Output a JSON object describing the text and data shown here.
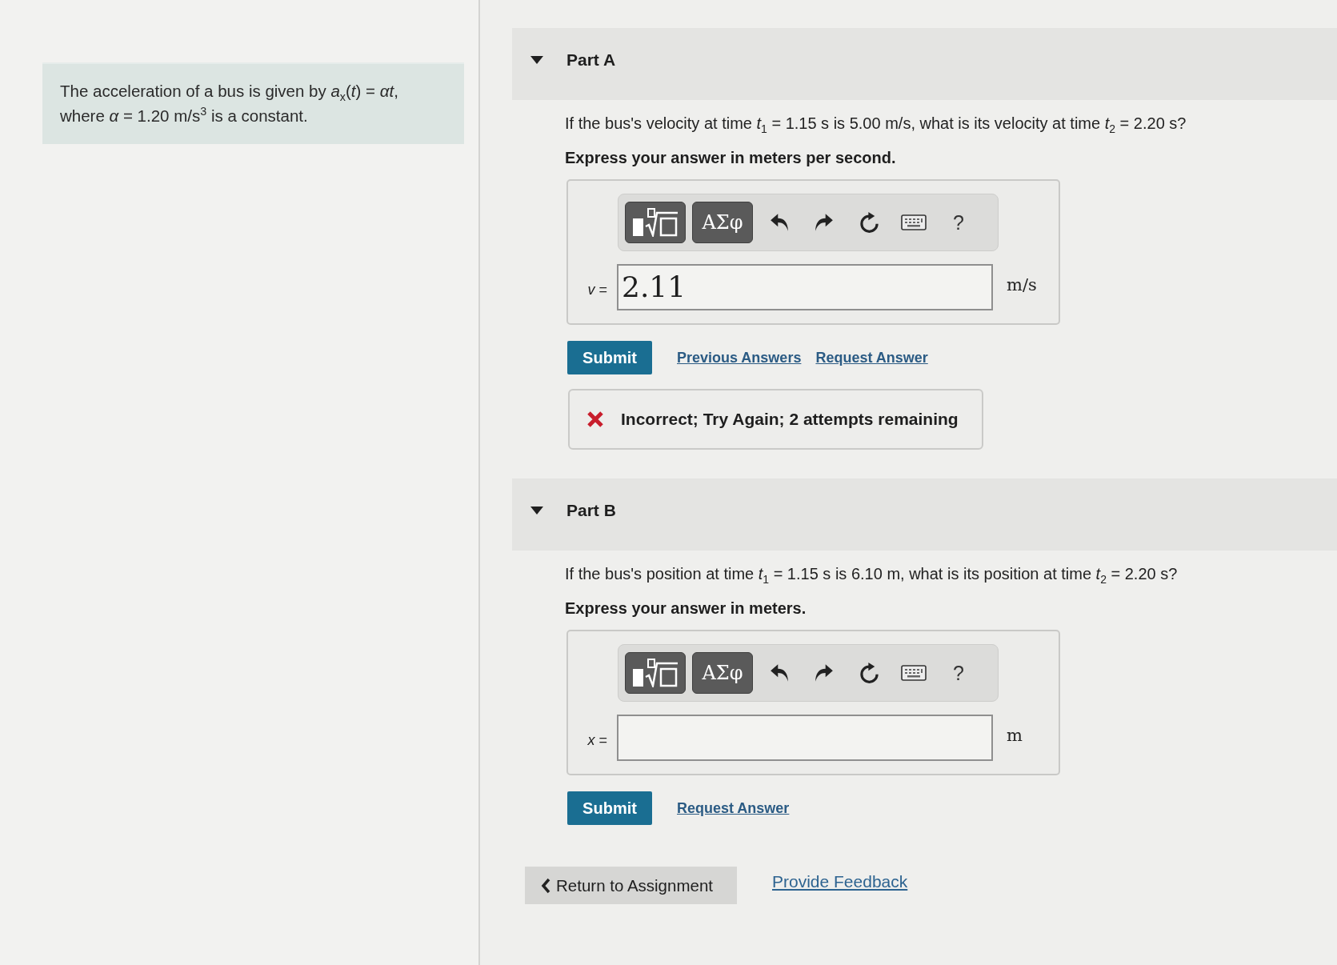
{
  "problem": {
    "text": "The acceleration of a bus is given by *a*$_{x}$(*t*) = *αt*, where *α* = 1.20 m/s$^{3}$ is a constant."
  },
  "parts": [
    {
      "title": "Part A",
      "expanded": true,
      "question": "If the bus's velocity at time *t*$_{1}$ = 1.15 s is 5.00 m/s, what is its velocity at time *t*$_{2}$ = 2.20 s?",
      "instruction": "Express your answer in meters per second.",
      "toolbar": [
        {
          "kind": "templates"
        },
        {
          "kind": "symbols",
          "label": "ΑΣφ"
        },
        {
          "kind": "undo"
        },
        {
          "kind": "redo"
        },
        {
          "kind": "reset"
        },
        {
          "kind": "keyboard"
        },
        {
          "kind": "help",
          "label": "?"
        }
      ],
      "variable": "*v* =",
      "value": "2.11",
      "unit": "m/s",
      "actions": [
        {
          "kind": "submit",
          "label": "Submit"
        },
        {
          "kind": "link",
          "label": "Previous Answers"
        },
        {
          "kind": "link",
          "label": "Request Answer"
        }
      ],
      "feedback": {
        "correct": false,
        "text": "Incorrect; Try Again; 2 attempts remaining"
      }
    },
    {
      "title": "Part B",
      "expanded": true,
      "question": "If the bus's position at time *t*$_{1}$ = 1.15 s is 6.10 m, what is its position at time *t*$_{2}$ = 2.20 s?",
      "instruction": "Express your answer in meters.",
      "toolbar": [
        {
          "kind": "templates"
        },
        {
          "kind": "symbols",
          "label": "ΑΣφ"
        },
        {
          "kind": "undo"
        },
        {
          "kind": "redo"
        },
        {
          "kind": "reset"
        },
        {
          "kind": "keyboard"
        },
        {
          "kind": "help",
          "label": "?"
        }
      ],
      "variable": "*x* =",
      "unit": "m",
      "actions": [
        {
          "kind": "submit",
          "label": "Submit"
        },
        {
          "kind": "link",
          "label": "Request Answer"
        }
      ]
    }
  ],
  "footer": {
    "back_button": "Return to Assignment",
    "feedback_link": "Provide Feedback"
  }
}
